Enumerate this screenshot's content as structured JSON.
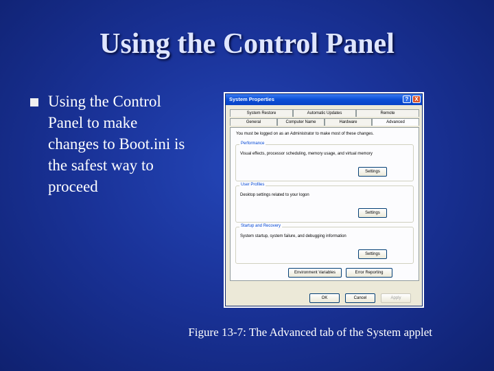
{
  "slide": {
    "title": "Using the Control Panel",
    "bullet": "Using the Control Panel to make changes to Boot.ini is the safest way to proceed",
    "caption": "Figure 13-7: The Advanced tab of the System applet"
  },
  "dialog": {
    "title": "System Properties",
    "help_label": "?",
    "close_label": "X",
    "tabs_row1": [
      "System Restore",
      "Automatic Updates",
      "Remote"
    ],
    "tabs_row2": [
      "General",
      "Computer Name",
      "Hardware",
      "Advanced"
    ],
    "note": "You must be logged on as an Administrator to make most of these changes.",
    "groups": [
      {
        "label": "Performance",
        "desc": "Visual effects, processor scheduling, memory usage, and virtual memory",
        "button": "Settings"
      },
      {
        "label": "User Profiles",
        "desc": "Desktop settings related to your logon",
        "button": "Settings"
      },
      {
        "label": "Startup and Recovery",
        "desc": "System startup, system failure, and debugging information",
        "button": "Settings"
      }
    ],
    "env_button": "Environment Variables",
    "error_button": "Error Reporting",
    "ok_button": "OK",
    "cancel_button": "Cancel",
    "apply_button": "Apply"
  }
}
